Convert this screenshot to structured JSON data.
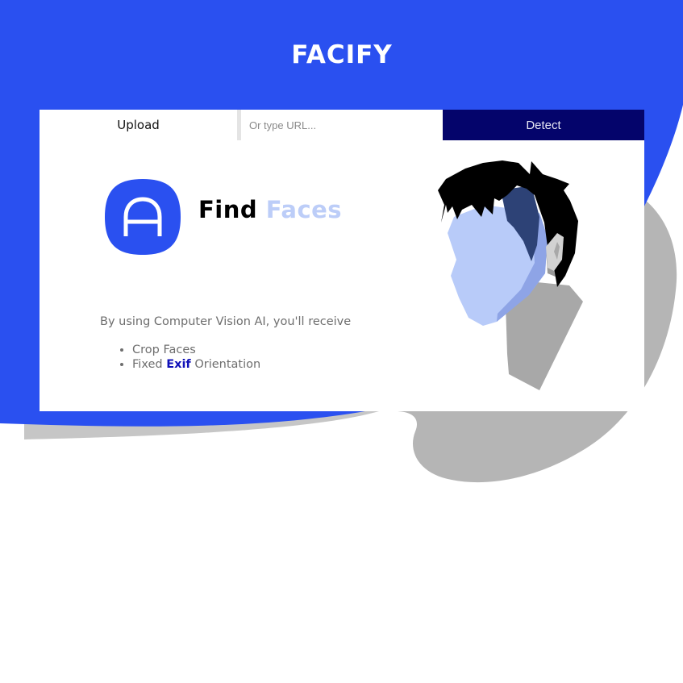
{
  "brand": {
    "name": "FACIFY",
    "color": "#ffffff",
    "background": "#2a50f0"
  },
  "toolbar": {
    "upload_label": "Upload",
    "url_placeholder": "Or type URL...",
    "url_value": "",
    "detect_label": "Detect",
    "detect_color": "#04046b"
  },
  "hero": {
    "icon": "app-logo-icon",
    "title_word1": "Find",
    "title_word2": "Faces",
    "title_accent": "#bccdf8"
  },
  "intro": {
    "text": "By using Computer Vision AI, you'll receive"
  },
  "features": [
    {
      "text": "Crop Faces"
    },
    {
      "prefix": "Fixed ",
      "highlight": "Exif",
      "suffix": " Orientation"
    }
  ],
  "illustration": {
    "icon": "person-face-illustration-icon",
    "face_color": "#b8cbf9",
    "hair_color": "#000000",
    "neck_color": "#a8a8a8"
  }
}
